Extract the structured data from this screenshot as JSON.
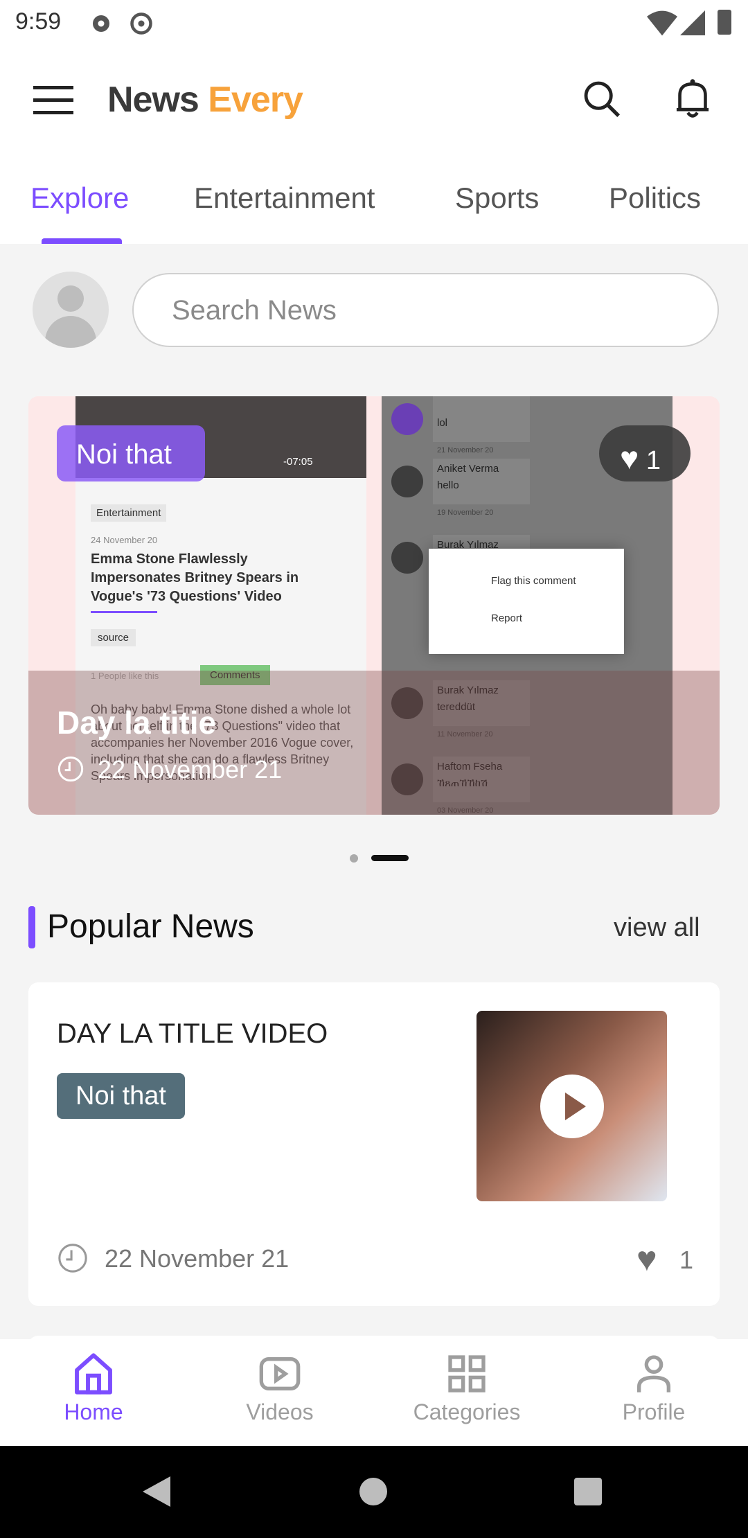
{
  "status_bar": {
    "time": "9:59"
  },
  "header": {
    "title_part1": "News",
    "title_part2": "Every",
    "brand_dark": "#3a3a3a",
    "brand_accent": "#f7a23b"
  },
  "tabs": [
    {
      "label": "Explore",
      "active": true
    },
    {
      "label": "Entertainment"
    },
    {
      "label": "Sports"
    },
    {
      "label": "Politics"
    }
  ],
  "accent": "#7c4dff",
  "search": {
    "placeholder": "Search News"
  },
  "banner": {
    "tag": "Noi that",
    "likes": "1",
    "title": "Day la titie",
    "date": "22 November 21",
    "image": {
      "category": "Entertainment",
      "date": "24 November 20",
      "headline": "Emma Stone Flawlessly Impersonates Britney Spears in Vogue's '73 Questions' Video",
      "source": "source",
      "likes_text": "1 People like this",
      "comments": "Comments",
      "body": "Oh baby baby! Emma Stone dished a whole lot about herself in the \"73 Questions\" video that accompanies her November 2016 Vogue cover, including that she can do a flawless Britney Spears impersonation.",
      "video_time": "-07:05",
      "comments_list": [
        {
          "name": "",
          "text": "lol",
          "date": "21 November 20"
        },
        {
          "name": "Aniket Verma",
          "text": "hello",
          "date": "19 November 20"
        },
        {
          "name": "Burak Yılmaz",
          "text": "",
          "date": ""
        },
        {
          "name": "Burak Yılmaz",
          "text": "tereddüt",
          "date": "11 November 20"
        },
        {
          "name": "Haftom Fseha",
          "text": "ኸጸጠኸኸከሽ",
          "date": "03 November 20"
        }
      ],
      "menu": [
        "Flag this comment",
        "Report"
      ]
    },
    "carousel_active_index": 1,
    "carousel_count": 2
  },
  "popular": {
    "title": "Popular News",
    "view_all": "view all",
    "items": [
      {
        "title": "DAY LA TITLE VIDEO",
        "tag": "Noi that",
        "date": "22 November 21",
        "likes": "1",
        "has_video": true
      }
    ]
  },
  "bottom_nav": [
    {
      "label": "Home",
      "icon": "home-icon",
      "active": true
    },
    {
      "label": "Videos",
      "icon": "video-icon"
    },
    {
      "label": "Categories",
      "icon": "grid-icon"
    },
    {
      "label": "Profile",
      "icon": "person-icon"
    }
  ]
}
